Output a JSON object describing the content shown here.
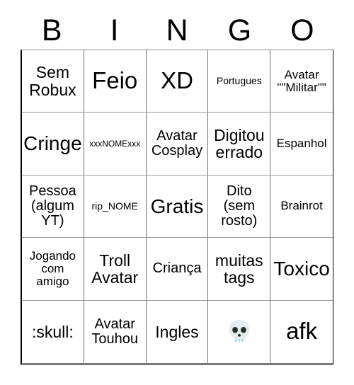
{
  "card": {
    "header_letters": [
      "B",
      "I",
      "N",
      "G",
      "O"
    ],
    "colors": {
      "background": "#ffffff",
      "text": "#000000",
      "grid_line": "#6f6f6f",
      "outer_border": "#000000",
      "emoji_skull_fill": "#e3ecef",
      "emoji_skull_detail": "#2b2b2b"
    },
    "rows": [
      [
        {
          "text": "Sem\nRobux",
          "size": "fs-md"
        },
        {
          "text": "Feio",
          "size": "fs-xl"
        },
        {
          "text": "XD",
          "size": "fs-xl"
        },
        {
          "text": "Portugues",
          "size": "fs-xxs"
        },
        {
          "text": "Avatar\n\"\"Militar\"\"",
          "size": "fs-xs"
        }
      ],
      [
        {
          "text": "Cringe",
          "size": "fs-lg"
        },
        {
          "text": "xxxNOMExxx",
          "size": "fs-tiny"
        },
        {
          "text": "Avatar\nCosplay",
          "size": "fs-sm"
        },
        {
          "text": "Digitou\nerrado",
          "size": "fs-md"
        },
        {
          "text": "Espanhol",
          "size": "fs-xs"
        }
      ],
      [
        {
          "text": "Pessoa\n(algum\nYT)",
          "size": "fs-sm"
        },
        {
          "text": "rip_NOME",
          "size": "fs-xxs"
        },
        {
          "text": "Gratis",
          "size": "fs-lg"
        },
        {
          "text": "Dito\n(sem\nrosto)",
          "size": "fs-sm"
        },
        {
          "text": "Brainrot",
          "size": "fs-xs"
        }
      ],
      [
        {
          "text": "Jogando\ncom\namigo",
          "size": "fs-xs"
        },
        {
          "text": "Troll\nAvatar",
          "size": "fs-md"
        },
        {
          "text": "Criança",
          "size": "fs-sm"
        },
        {
          "text": "muitas\ntags",
          "size": "fs-md"
        },
        {
          "text": "Toxico",
          "size": "fs-lg"
        }
      ],
      [
        {
          "text": ":skull:",
          "size": "fs-md"
        },
        {
          "text": "Avatar\nTouhou",
          "size": "fs-sm"
        },
        {
          "text": "Ingles",
          "size": "fs-md"
        },
        {
          "text": "💀",
          "size": "fs-md",
          "emoji": "skull"
        },
        {
          "text": "afk",
          "size": "fs-xl"
        }
      ]
    ]
  }
}
